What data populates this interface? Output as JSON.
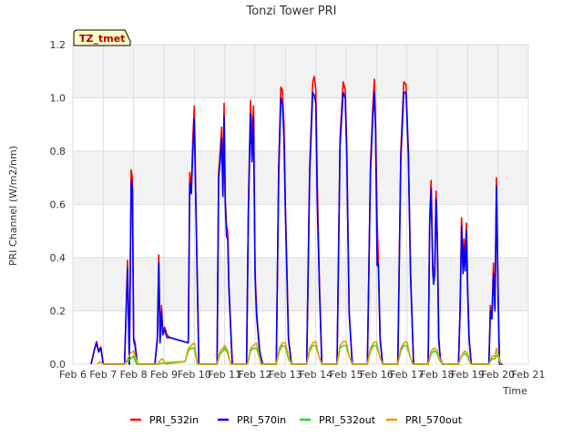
{
  "chart_data": {
    "type": "line",
    "title": "Tonzi Tower PRI",
    "xlabel": "Time",
    "ylabel": "PRI Channel (W/m2/nm)",
    "ylim": [
      0.0,
      1.2
    ],
    "xlim": [
      6,
      21
    ],
    "x_tick_labels": [
      "Feb 6",
      "Feb 7",
      "Feb 8",
      "Feb 9",
      "Feb 10",
      "Feb 11",
      "Feb 12",
      "Feb 13",
      "Feb 14",
      "Feb 15",
      "Feb 16",
      "Feb 17",
      "Feb 18",
      "Feb 19",
      "Feb 20",
      "Feb 21"
    ],
    "y_tick_labels": [
      "0.0",
      "0.2",
      "0.4",
      "0.6",
      "0.8",
      "1.0",
      "1.2"
    ],
    "annotation": "TZ_tmet",
    "grid": true,
    "legend_position": "bottom",
    "series": [
      {
        "name": "PRI_532in",
        "color": "#ff0000",
        "x": [
          6.6,
          6.7,
          6.78,
          6.85,
          6.92,
          7.0,
          7.05,
          7.7,
          7.8,
          7.86,
          7.92,
          7.96,
          8.0,
          8.05,
          8.12,
          8.2,
          8.7,
          8.78,
          8.83,
          8.87,
          8.92,
          8.96,
          9.02,
          9.1,
          9.2,
          9.8,
          9.85,
          9.9,
          9.95,
          10.0,
          10.05,
          10.15,
          10.75,
          10.8,
          10.85,
          10.9,
          10.94,
          10.98,
          11.02,
          11.06,
          11.1,
          11.14,
          11.25,
          11.72,
          11.78,
          11.85,
          11.9,
          11.95,
          12.0,
          12.05,
          12.15,
          12.25,
          12.7,
          12.78,
          12.85,
          12.9,
          12.95,
          13.0,
          13.1,
          13.2,
          13.7,
          13.8,
          13.9,
          13.95,
          14.0,
          14.05,
          14.12,
          14.2,
          14.7,
          14.8,
          14.9,
          14.97,
          15.02,
          15.1,
          15.2,
          15.7,
          15.8,
          15.88,
          15.93,
          15.97,
          16.02,
          16.06,
          16.12,
          16.2,
          16.7,
          16.8,
          16.9,
          16.97,
          17.05,
          17.12,
          17.22,
          17.7,
          17.75,
          17.8,
          17.85,
          17.88,
          17.92,
          17.96,
          18.0,
          18.05,
          18.1,
          18.18,
          18.7,
          18.75,
          18.8,
          18.85,
          18.88,
          18.92,
          18.96,
          19.0,
          19.05,
          19.12,
          19.7,
          19.75,
          19.8,
          19.85,
          19.9,
          19.95,
          20.0,
          20.05,
          20.1,
          20.15
        ],
        "y": [
          0.0,
          0.05,
          0.085,
          0.05,
          0.065,
          0.0,
          0.0,
          0.0,
          0.39,
          0.0,
          0.73,
          0.7,
          0.1,
          0.08,
          0.0,
          0.0,
          0.0,
          0.1,
          0.41,
          0.09,
          0.22,
          0.12,
          0.14,
          0.11,
          0.1,
          0.08,
          0.72,
          0.65,
          0.85,
          0.97,
          0.62,
          0.0,
          0.0,
          0.72,
          0.8,
          0.89,
          0.65,
          0.98,
          0.62,
          0.52,
          0.5,
          0.3,
          0.0,
          0.0,
          0.6,
          0.99,
          0.85,
          0.97,
          0.35,
          0.2,
          0.05,
          0.0,
          0.0,
          0.75,
          1.04,
          1.03,
          0.9,
          0.6,
          0.1,
          0.0,
          0.0,
          0.75,
          1.06,
          1.08,
          1.03,
          0.68,
          0.3,
          0.0,
          0.0,
          0.85,
          1.06,
          1.03,
          0.8,
          0.2,
          0.0,
          0.0,
          0.75,
          0.97,
          1.07,
          0.9,
          0.54,
          0.4,
          0.1,
          0.0,
          0.0,
          0.8,
          1.06,
          1.05,
          0.8,
          0.35,
          0.0,
          0.0,
          0.55,
          0.69,
          0.38,
          0.32,
          0.37,
          0.65,
          0.5,
          0.1,
          0.02,
          0.0,
          0.0,
          0.2,
          0.55,
          0.36,
          0.47,
          0.4,
          0.53,
          0.3,
          0.1,
          0.0,
          0.0,
          0.22,
          0.18,
          0.38,
          0.21,
          0.7,
          0.3,
          0.0,
          0.0,
          0.0
        ]
      },
      {
        "name": "PRI_570in",
        "color": "#0000ff",
        "x": [
          6.6,
          6.7,
          6.78,
          6.85,
          6.92,
          7.0,
          7.05,
          7.7,
          7.8,
          7.86,
          7.92,
          7.96,
          8.0,
          8.05,
          8.12,
          8.2,
          8.7,
          8.78,
          8.83,
          8.87,
          8.92,
          8.96,
          9.02,
          9.1,
          9.2,
          9.8,
          9.85,
          9.9,
          9.95,
          10.0,
          10.05,
          10.15,
          10.75,
          10.8,
          10.85,
          10.9,
          10.94,
          10.98,
          11.02,
          11.06,
          11.1,
          11.14,
          11.25,
          11.72,
          11.78,
          11.85,
          11.9,
          11.95,
          12.0,
          12.05,
          12.15,
          12.25,
          12.7,
          12.78,
          12.85,
          12.9,
          12.95,
          13.0,
          13.1,
          13.2,
          13.7,
          13.8,
          13.9,
          13.95,
          14.0,
          14.05,
          14.12,
          14.2,
          14.7,
          14.8,
          14.9,
          14.97,
          15.02,
          15.1,
          15.2,
          15.7,
          15.8,
          15.88,
          15.93,
          15.97,
          16.02,
          16.06,
          16.12,
          16.2,
          16.7,
          16.8,
          16.9,
          16.97,
          17.05,
          17.12,
          17.22,
          17.7,
          17.75,
          17.8,
          17.85,
          17.88,
          17.92,
          17.96,
          18.0,
          18.05,
          18.1,
          18.18,
          18.7,
          18.75,
          18.8,
          18.85,
          18.88,
          18.92,
          18.96,
          19.0,
          19.05,
          19.12,
          19.7,
          19.75,
          19.8,
          19.85,
          19.9,
          19.95,
          20.0,
          20.05,
          20.1,
          20.15
        ],
        "y": [
          0.0,
          0.05,
          0.08,
          0.045,
          0.06,
          0.0,
          0.0,
          0.0,
          0.36,
          0.0,
          0.69,
          0.66,
          0.09,
          0.07,
          0.0,
          0.0,
          0.0,
          0.09,
          0.38,
          0.08,
          0.2,
          0.11,
          0.13,
          0.1,
          0.1,
          0.08,
          0.68,
          0.64,
          0.8,
          0.92,
          0.6,
          0.0,
          0.0,
          0.7,
          0.76,
          0.85,
          0.63,
          0.93,
          0.6,
          0.48,
          0.47,
          0.28,
          0.0,
          0.0,
          0.57,
          0.94,
          0.76,
          0.93,
          0.33,
          0.18,
          0.05,
          0.0,
          0.0,
          0.72,
          1.0,
          0.98,
          0.85,
          0.57,
          0.09,
          0.0,
          0.0,
          0.72,
          1.02,
          1.01,
          0.98,
          0.6,
          0.28,
          0.0,
          0.0,
          0.82,
          1.02,
          1.0,
          0.78,
          0.19,
          0.0,
          0.0,
          0.72,
          0.93,
          1.02,
          0.87,
          0.37,
          0.38,
          0.09,
          0.0,
          0.0,
          0.77,
          1.02,
          1.02,
          0.78,
          0.33,
          0.0,
          0.0,
          0.52,
          0.66,
          0.35,
          0.3,
          0.34,
          0.62,
          0.47,
          0.09,
          0.02,
          0.0,
          0.0,
          0.19,
          0.52,
          0.34,
          0.44,
          0.35,
          0.5,
          0.28,
          0.09,
          0.0,
          0.0,
          0.2,
          0.17,
          0.34,
          0.2,
          0.67,
          0.28,
          0.0,
          0.0,
          0.0
        ]
      },
      {
        "name": "PRI_532out",
        "color": "#22dd22",
        "x": [
          7.7,
          7.9,
          8.0,
          8.1,
          8.8,
          9.0,
          9.7,
          9.8,
          9.9,
          10.0,
          10.1,
          10.75,
          10.85,
          10.95,
          11.0,
          11.1,
          11.2,
          11.75,
          11.85,
          11.95,
          12.05,
          12.2,
          12.7,
          12.8,
          12.9,
          13.0,
          13.1,
          13.2,
          13.7,
          13.8,
          13.9,
          14.0,
          14.1,
          14.2,
          14.7,
          14.8,
          14.9,
          15.0,
          15.1,
          15.2,
          15.7,
          15.8,
          15.9,
          16.0,
          16.1,
          16.2,
          16.7,
          16.8,
          16.9,
          17.0,
          17.1,
          17.2,
          17.7,
          17.8,
          17.9,
          18.0,
          18.1,
          18.2,
          18.7,
          18.8,
          18.9,
          19.0,
          19.1,
          19.7,
          19.8,
          19.9,
          20.0,
          20.1
        ],
        "y": [
          0.0,
          0.02,
          0.03,
          0.0,
          0.0,
          0.005,
          0.01,
          0.05,
          0.06,
          0.06,
          0.0,
          0.0,
          0.04,
          0.05,
          0.06,
          0.04,
          0.0,
          0.0,
          0.05,
          0.06,
          0.06,
          0.0,
          0.0,
          0.05,
          0.07,
          0.065,
          0.02,
          0.0,
          0.0,
          0.05,
          0.07,
          0.07,
          0.03,
          0.0,
          0.0,
          0.06,
          0.07,
          0.07,
          0.03,
          0.0,
          0.0,
          0.05,
          0.07,
          0.07,
          0.03,
          0.0,
          0.0,
          0.05,
          0.07,
          0.07,
          0.03,
          0.0,
          0.0,
          0.04,
          0.05,
          0.04,
          0.01,
          0.0,
          0.0,
          0.03,
          0.04,
          0.03,
          0.0,
          0.0,
          0.02,
          0.02,
          0.04,
          0.0
        ]
      },
      {
        "name": "PRI_570out",
        "color": "#e8a000",
        "x": [
          6.8,
          6.9,
          7.0,
          7.7,
          7.8,
          7.9,
          8.0,
          8.05,
          8.15,
          8.8,
          8.88,
          8.95,
          9.05,
          9.7,
          9.8,
          9.9,
          10.0,
          10.1,
          10.75,
          10.85,
          10.95,
          11.0,
          11.1,
          11.2,
          11.75,
          11.85,
          11.95,
          12.05,
          12.2,
          12.7,
          12.8,
          12.9,
          13.0,
          13.1,
          13.2,
          13.7,
          13.8,
          13.9,
          14.0,
          14.1,
          14.2,
          14.7,
          14.8,
          14.9,
          15.0,
          15.1,
          15.2,
          15.7,
          15.8,
          15.9,
          16.0,
          16.1,
          16.2,
          16.7,
          16.8,
          16.9,
          17.0,
          17.1,
          17.2,
          17.7,
          17.8,
          17.9,
          18.0,
          18.1,
          18.2,
          18.7,
          18.8,
          18.9,
          19.0,
          19.1,
          19.7,
          19.8,
          19.9,
          19.95,
          20.0,
          20.1
        ],
        "y": [
          0.0,
          0.01,
          0.0,
          0.0,
          0.02,
          0.04,
          0.05,
          0.03,
          0.0,
          0.0,
          0.015,
          0.02,
          0.0,
          0.01,
          0.06,
          0.07,
          0.08,
          0.0,
          0.0,
          0.05,
          0.06,
          0.07,
          0.05,
          0.0,
          0.0,
          0.06,
          0.07,
          0.08,
          0.0,
          0.0,
          0.06,
          0.08,
          0.08,
          0.03,
          0.0,
          0.0,
          0.06,
          0.08,
          0.085,
          0.03,
          0.0,
          0.0,
          0.07,
          0.085,
          0.085,
          0.03,
          0.0,
          0.0,
          0.06,
          0.08,
          0.085,
          0.03,
          0.0,
          0.0,
          0.06,
          0.08,
          0.085,
          0.03,
          0.0,
          0.0,
          0.05,
          0.06,
          0.05,
          0.015,
          0.0,
          0.0,
          0.03,
          0.05,
          0.04,
          0.0,
          0.0,
          0.03,
          0.03,
          0.06,
          0.03,
          0.0
        ]
      }
    ]
  }
}
